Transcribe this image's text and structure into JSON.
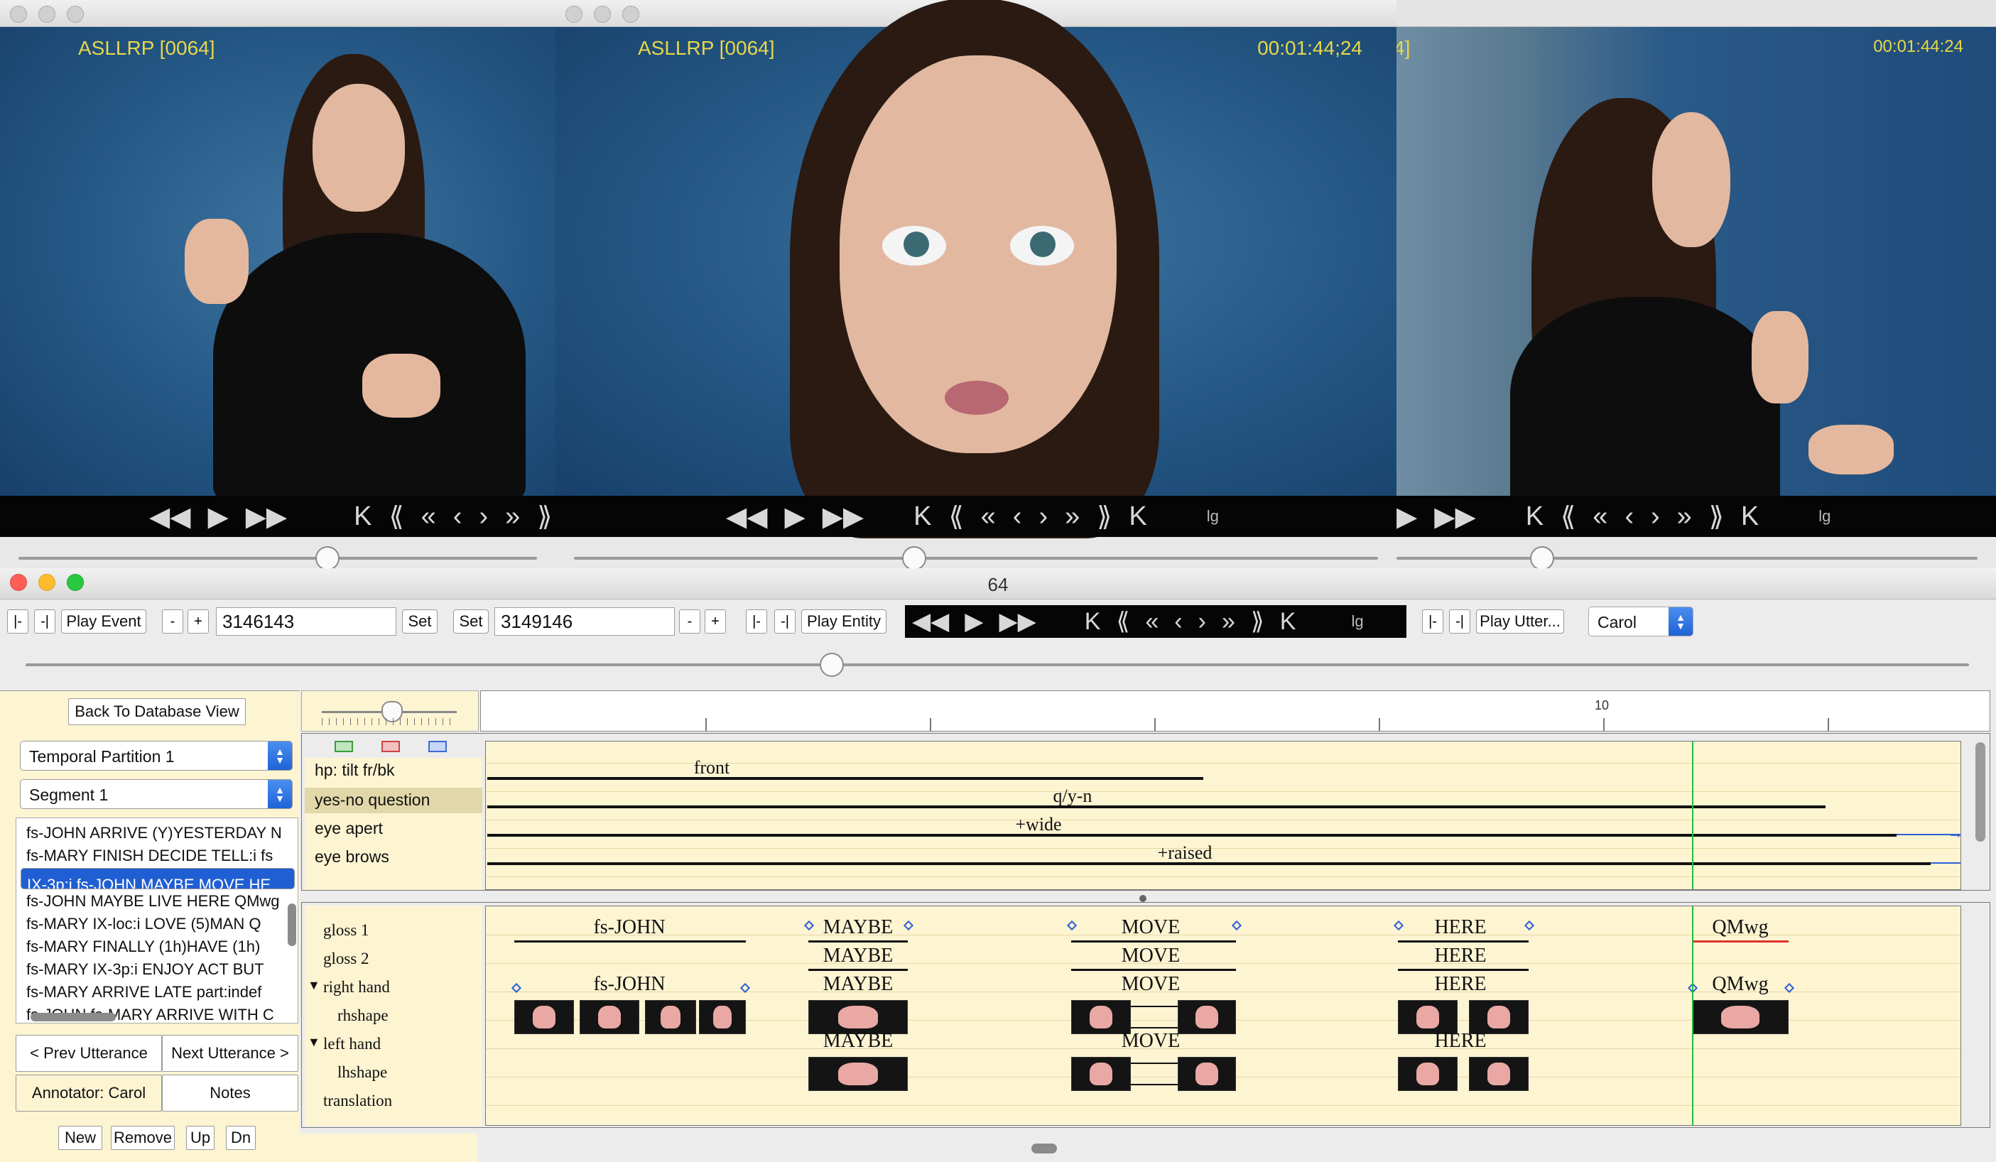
{
  "video_windows": [
    {
      "overlay_left": "ASLLRP [0064]",
      "overlay_right": "",
      "speed": ""
    },
    {
      "overlay_left": "ASLLRP [0064]",
      "overlay_right": "00:01:44;24",
      "speed": "lg"
    },
    {
      "overlay_left": "4]",
      "overlay_right": "00:01:44:24",
      "speed": "lg"
    }
  ],
  "transport_glyphs": {
    "rew": "◀◀",
    "play": "▶",
    "ff": "▶▶",
    "start": "K",
    "back3": "⟪",
    "back2": "«",
    "back1": "‹",
    "fwd1": "›",
    "fwd2": "»",
    "fwd3": "⟫",
    "end": "K"
  },
  "main": {
    "title": "64",
    "toolbar": {
      "minus_bar": "|-",
      "minus_bar2": "-|",
      "play_event": "Play Event",
      "minus": "-",
      "plus": "+",
      "start_value": "3146143",
      "set1": "Set",
      "set2": "Set",
      "end_value": "3149146",
      "play_entity": "Play Entity",
      "speed": "lg",
      "play_utter": "Play Utter...",
      "annotator_select": "Carol"
    },
    "left_panel": {
      "back_button": "Back To Database View",
      "partition_select": "Temporal Partition 1",
      "segment_select": "Segment 1",
      "utterances": [
        "fs-JOHN ARRIVE (Y)YESTERDAY N",
        "fs-MARY FINISH DECIDE TELL:i fs",
        "IX-3p:i fs-JOHN MAYBE MOVE HE",
        "fs-JOHN MAYBE LIVE HERE QMwg",
        "fs-MARY IX-loc:i LOVE (5)MAN Q",
        "fs-MARY FINALLY (1h)HAVE (1h)",
        "fs-MARY IX-3p:i ENJOY ACT BUT",
        "fs-MARY ARRIVE LATE part:indef",
        "fs-JOHN fs-MARY ARRIVE WITH C"
      ],
      "selected_index": 2,
      "prev_button": "< Prev Utterance",
      "next_button": "Next Utterance >",
      "annotator_label": "Annotator: Carol",
      "notes_button": "Notes",
      "bottom_buttons": [
        "New",
        "Remove",
        "Up",
        "Dn"
      ]
    },
    "timeline": {
      "ruler_label": "10",
      "nonmanual_rows": [
        {
          "label": "hp: tilt fr/bk",
          "value": "front"
        },
        {
          "label": "yes-no question",
          "value": "q/y-n"
        },
        {
          "label": "eye apert",
          "value": "+wide"
        },
        {
          "label": "eye brows",
          "value": "+raised"
        }
      ],
      "manual_rows": [
        {
          "label": "gloss 1"
        },
        {
          "label": "gloss 2"
        },
        {
          "label": "right hand",
          "expand": "▼"
        },
        {
          "label": "rhshape"
        },
        {
          "label": "left hand",
          "expand": "▼"
        },
        {
          "label": "lhshape"
        },
        {
          "label": "translation"
        }
      ],
      "glosses": {
        "gloss1": [
          "fs-JOHN",
          "MAYBE",
          "MOVE",
          "HERE",
          "QMwg"
        ],
        "gloss2": [
          "MAYBE",
          "MOVE",
          "HERE"
        ],
        "right_hand": [
          "fs-JOHN",
          "MAYBE",
          "MOVE",
          "HERE",
          "QMwg"
        ],
        "left_hand": [
          "MAYBE",
          "MOVE",
          "HERE"
        ]
      }
    }
  },
  "colors": {
    "timeline_bg": "#fdf4d2",
    "selection": "#1f5fd3",
    "cursor": "#1fbf3a",
    "handle": "#2c5fd8"
  }
}
